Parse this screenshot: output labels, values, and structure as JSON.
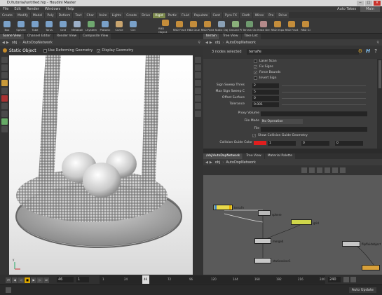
{
  "window": {
    "title": "D:/tutorial/untitled.hip - Houdini Master",
    "controls": [
      "−",
      "□",
      "×"
    ]
  },
  "menubar": {
    "items": [
      "File",
      "Edit",
      "Render",
      "Windows",
      "Help"
    ],
    "desktop": "Auto Takes",
    "desktop_value": "Main"
  },
  "shelf_tabs": [
    "Create",
    "Modify",
    "Model",
    "Poly",
    "Deform",
    "Text",
    "Char",
    "Anim",
    "Lights",
    "Create",
    "Drive",
    "Rigid",
    "Partic",
    "Fluid",
    "Populate",
    "Cont",
    "Pyro FX",
    "Cloth",
    "Wires",
    "Pro",
    "Drive"
  ],
  "shelf_active_tab": "Rigid",
  "shelf_tools_left": [
    {
      "label": "Box",
      "color": "#7aa1c9"
    },
    {
      "label": "Sphere",
      "color": "#7aa1c9"
    },
    {
      "label": "Tube",
      "color": "#7aa1c9"
    },
    {
      "label": "Torus",
      "color": "#7aa1c9"
    },
    {
      "label": "Grid",
      "color": "#7aa1c9"
    },
    {
      "label": "Metaball",
      "color": "#9cb0c9"
    },
    {
      "label": "LSystem",
      "color": "#6fa86f"
    },
    {
      "label": "Platonic",
      "color": "#7aa1c9"
    },
    {
      "label": "Curve",
      "color": "#c9a56f"
    },
    {
      "label": "Circ",
      "color": "#7aa1c9"
    }
  ],
  "shelf_tools_right": [
    {
      "label": "RBD Object",
      "color": "#c48d3b"
    },
    {
      "label": "RBD Fract",
      "color": "#c48d3b"
    },
    {
      "label": "RBD Glue",
      "color": "#c48d3b"
    },
    {
      "label": "RBD Point",
      "color": "#c48d3b"
    },
    {
      "label": "Static Obj",
      "color": "#8aa0b5"
    },
    {
      "label": "Ground Pl",
      "color": "#8ab07a"
    },
    {
      "label": "Terrain Ob",
      "color": "#6f9a6f"
    },
    {
      "label": "Make Bre",
      "color": "#b58a8a"
    },
    {
      "label": "RBD Impo",
      "color": "#c48d3b"
    },
    {
      "label": "RBD Fract",
      "color": "#c48d3b"
    },
    {
      "label": "RBD Gl",
      "color": "#c48d3b"
    }
  ],
  "viewer": {
    "pane_tabs": [
      "Scene View",
      "Channel Editor",
      "Render View",
      "Composite View"
    ],
    "path": "obj",
    "network": "AutoDopNetwork",
    "object": "Static Object",
    "use_deforming_geometry_label": "Use Deforming Geometry",
    "display_geometry_label": "Display Geometry",
    "axis": "y"
  },
  "params": {
    "pane_tabs": [
      "terrain",
      "Tree View",
      "Take List"
    ],
    "path": "obj",
    "network": "AutoDopNetwork",
    "selection": "3 nodes selected",
    "node_name": "terraFe",
    "checks": [
      {
        "label": "Laser Scan",
        "checked": false
      },
      {
        "label": "Fix Signs",
        "checked": true
      },
      {
        "label": "Force Bounds",
        "checked": true
      },
      {
        "label": "Invert Sign",
        "checked": false
      }
    ],
    "fields": [
      {
        "label": "Sign Sweep Thres",
        "value": "2"
      },
      {
        "label": "Max Sign Sweep C",
        "value": "5"
      },
      {
        "label": "Offset Surface",
        "value": "0"
      },
      {
        "label": "Tolerance",
        "value": "0.001"
      }
    ],
    "proxy_volume_label": "Proxy Volume",
    "file_mode_label": "File Mode",
    "file_mode_value": "No Operation",
    "file_label": "File",
    "show_guide_label": "Show Collision Guide Geometry",
    "guide_color_label": "Collision Guide Color",
    "guide_color_values": [
      "1",
      "0",
      "0"
    ],
    "guide_color": "#e01e1e"
  },
  "network": {
    "pane_tabs": [
      "/obj/AutoDopNetwork",
      "Tree View",
      "Material Palette"
    ],
    "path": "obj",
    "network": "AutoDopNetwork",
    "nodes": [
      {
        "label": "terraFe"
      },
      {
        "label": "sphere"
      },
      {
        "label": "grid"
      },
      {
        "label": "merge4"
      },
      {
        "label": "staticsolver1"
      },
      {
        "label": "flipfluidobject"
      }
    ]
  },
  "timeline": {
    "frame": "46",
    "start": "1",
    "end": "240",
    "ticks": [
      "1",
      "24",
      "48",
      "72",
      "96",
      "120",
      "144",
      "168",
      "192",
      "216",
      "240"
    ],
    "current_tick": "46",
    "current_fraction": 0.188
  },
  "status": {
    "update_mode": "Auto Update"
  }
}
